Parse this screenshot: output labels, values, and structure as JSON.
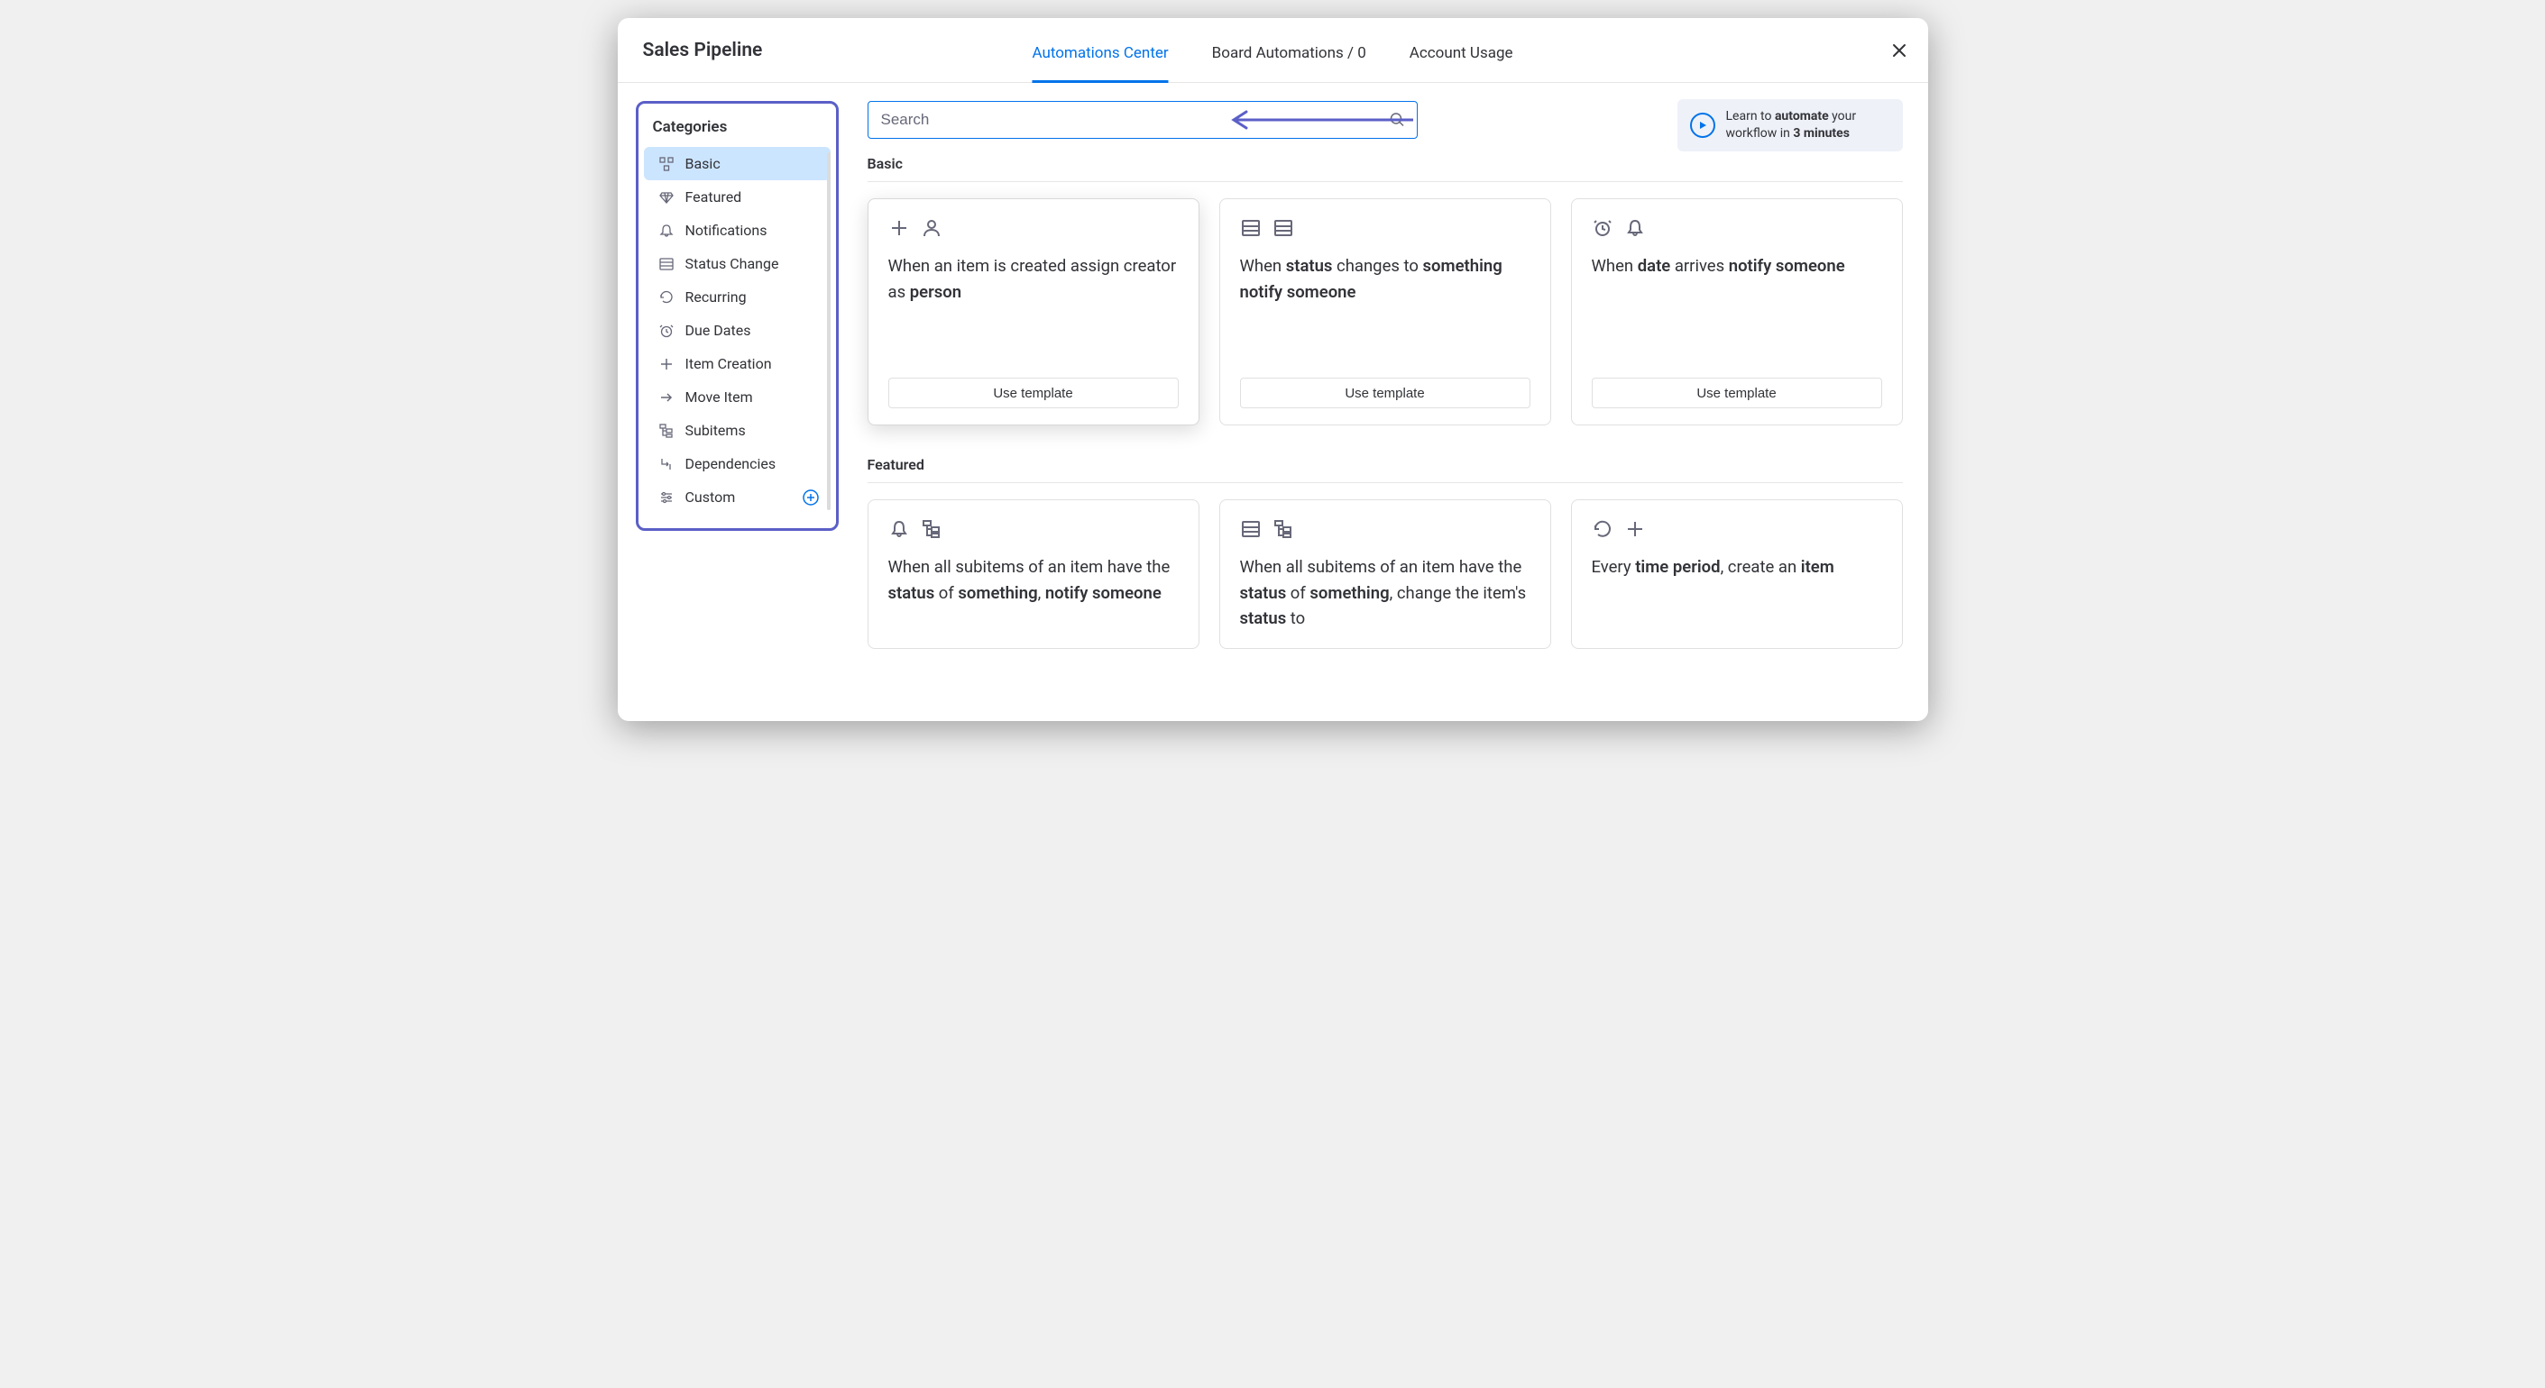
{
  "header": {
    "title": "Sales Pipeline",
    "tabs": [
      "Automations Center",
      "Board Automations / 0",
      "Account Usage"
    ],
    "activeTab": 0
  },
  "sidebar": {
    "title": "Categories",
    "items": [
      {
        "label": "Basic",
        "icon": "grid-icon",
        "active": true
      },
      {
        "label": "Featured",
        "icon": "diamond-icon"
      },
      {
        "label": "Notifications",
        "icon": "bell-icon"
      },
      {
        "label": "Status Change",
        "icon": "list-icon"
      },
      {
        "label": "Recurring",
        "icon": "recurring-icon"
      },
      {
        "label": "Due Dates",
        "icon": "alarm-icon"
      },
      {
        "label": "Item Creation",
        "icon": "plus-icon"
      },
      {
        "label": "Move Item",
        "icon": "arrow-right-icon"
      },
      {
        "label": "Subitems",
        "icon": "subitems-icon"
      },
      {
        "label": "Dependencies",
        "icon": "dependencies-icon"
      },
      {
        "label": "Custom",
        "icon": "sliders-icon",
        "extra": "plus-circle-icon"
      }
    ]
  },
  "search": {
    "placeholder": "Search"
  },
  "learn": {
    "pre": "Learn to ",
    "bold1": "automate",
    "mid": " your workflow in ",
    "bold2": "3 minutes"
  },
  "sections": {
    "basic": {
      "title": "Basic",
      "cards": [
        {
          "icons": [
            "plus-icon",
            "person-icon"
          ],
          "parts": [
            "When an item is created assign creator as ",
            "person"
          ],
          "useLabel": "Use template"
        },
        {
          "icons": [
            "list-icon",
            "list-icon"
          ],
          "parts": [
            "When ",
            "status",
            " changes to ",
            "something",
            " ",
            "notify",
            " ",
            "someone"
          ],
          "useLabel": "Use template"
        },
        {
          "icons": [
            "alarm-icon",
            "bell-icon"
          ],
          "parts": [
            "When ",
            "date",
            " arrives ",
            "notify",
            " ",
            "someone"
          ],
          "useLabel": "Use template"
        }
      ]
    },
    "featured": {
      "title": "Featured",
      "cards": [
        {
          "icons": [
            "bell-icon",
            "subitems-icon"
          ],
          "parts": [
            "When all subitems of an item have the ",
            "status",
            " of ",
            "something",
            ", ",
            "notify someone"
          ]
        },
        {
          "icons": [
            "list-icon",
            "subitems-icon"
          ],
          "parts": [
            "When all subitems of an item have the ",
            "status",
            " of ",
            "something",
            ", change the item's ",
            "status",
            " to"
          ]
        },
        {
          "icons": [
            "recurring-icon",
            "plus-icon"
          ],
          "parts": [
            "Every ",
            "time period",
            ", create an ",
            "item"
          ]
        }
      ]
    }
  }
}
